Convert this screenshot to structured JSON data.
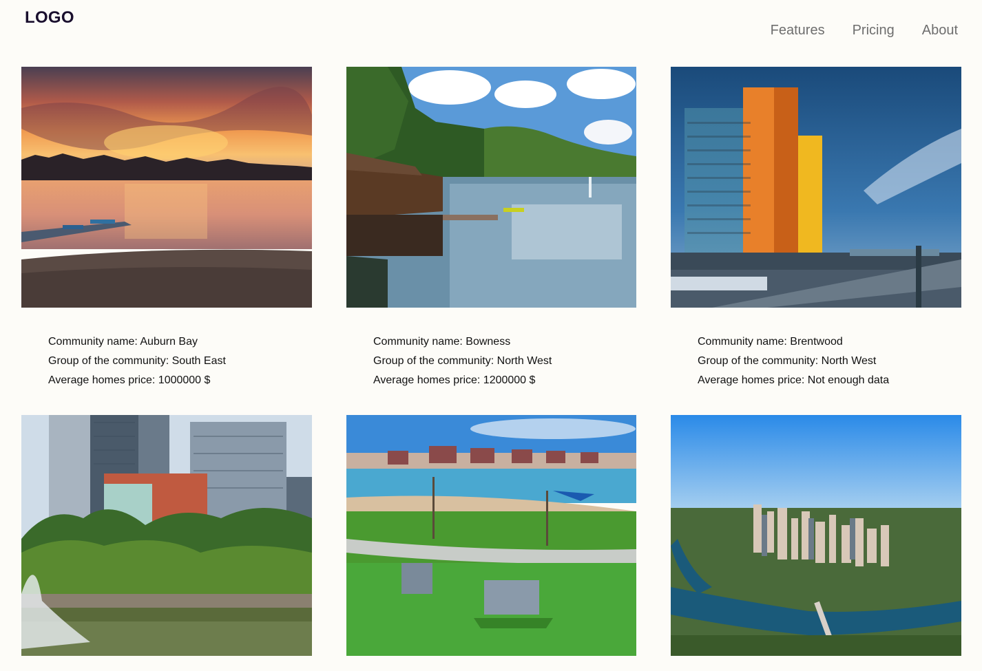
{
  "header": {
    "logo": "LOGO",
    "nav": [
      {
        "label": "Features"
      },
      {
        "label": "Pricing"
      },
      {
        "label": "About"
      }
    ]
  },
  "communities": [
    {
      "name_line": "Community name: Auburn Bay",
      "group_line": "Group of the community: South East",
      "price_line": "Average homes price: 1000000 $",
      "photo": "lake-sunset"
    },
    {
      "name_line": "Community name: Bowness",
      "group_line": "Group of the community: North West",
      "price_line": "Average homes price: 1200000 $",
      "photo": "park-lagoon"
    },
    {
      "name_line": "Community name: Brentwood",
      "group_line": "Group of the community: North West",
      "price_line": "Average homes price: Not enough data",
      "photo": "highrise-towers"
    },
    {
      "photo": "downtown-fountain"
    },
    {
      "photo": "lakeside-picnic"
    },
    {
      "photo": "city-aerial"
    }
  ]
}
